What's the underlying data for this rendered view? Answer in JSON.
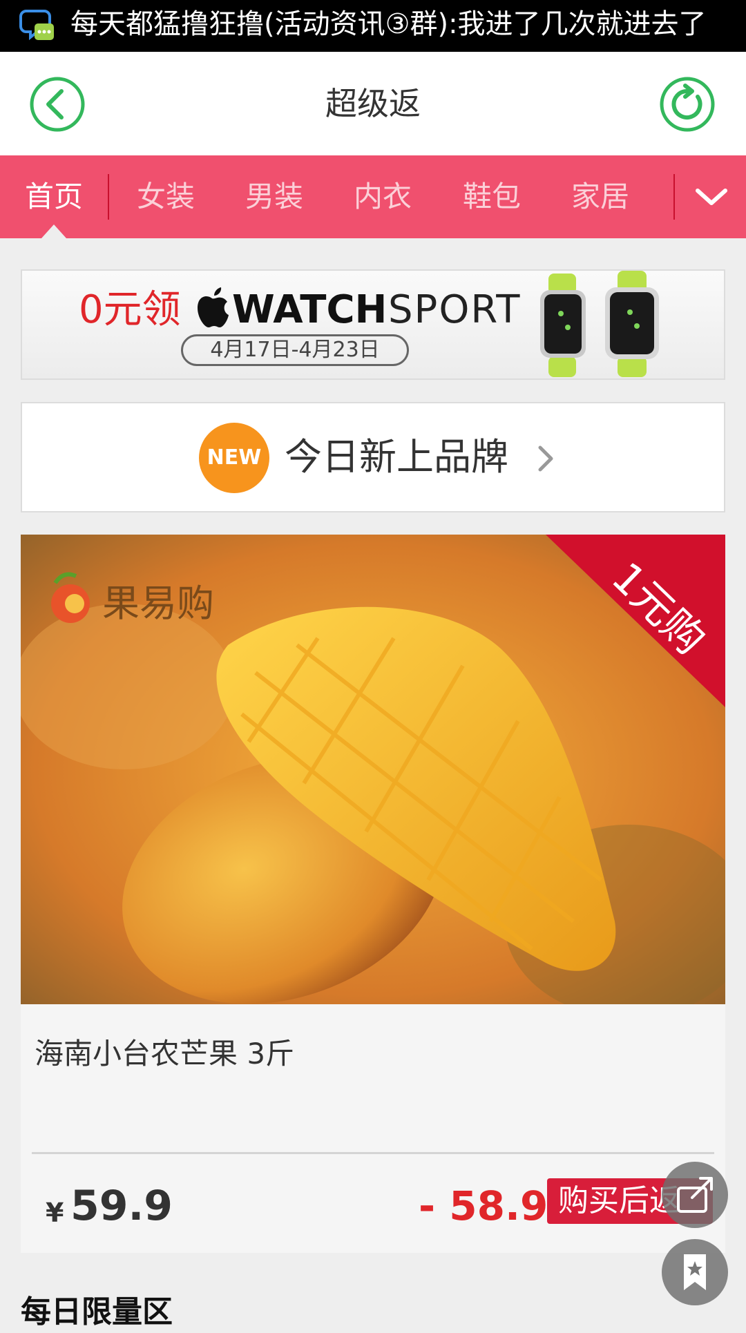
{
  "notification": {
    "icon": "chat-bubble-icon",
    "text": "每天都猛撸狂撸(活动资讯③群):我进了几次就进去了"
  },
  "header": {
    "title": "超级返",
    "back_icon": "back-arrow-icon",
    "refresh_icon": "refresh-icon",
    "accent_color": "#33b85c"
  },
  "categories": {
    "items": [
      {
        "label": "首页",
        "active": true
      },
      {
        "label": "女装",
        "active": false
      },
      {
        "label": "男装",
        "active": false
      },
      {
        "label": "内衣",
        "active": false
      },
      {
        "label": "鞋包",
        "active": false
      },
      {
        "label": "家居",
        "active": false
      }
    ],
    "more_icon": "chevron-down-icon",
    "bar_color": "#f0506e"
  },
  "banner": {
    "prefix": "0元领",
    "brand": "WATCH",
    "suffix": "SPORT",
    "dates": "4月17日-4月23日"
  },
  "new_brands": {
    "badge": "NEW",
    "label": "今日新上品牌"
  },
  "product": {
    "logo_text": "果易购",
    "ribbon": "1元购",
    "name": "海南小台农芒果 3斤",
    "currency": "¥",
    "price": "59.9",
    "rebate": "- 58.9",
    "rebate_label": "购买后返"
  },
  "floating": {
    "share_icon": "share-icon",
    "bookmark_icon": "bookmark-icon"
  },
  "section": {
    "title": "每日限量区"
  }
}
